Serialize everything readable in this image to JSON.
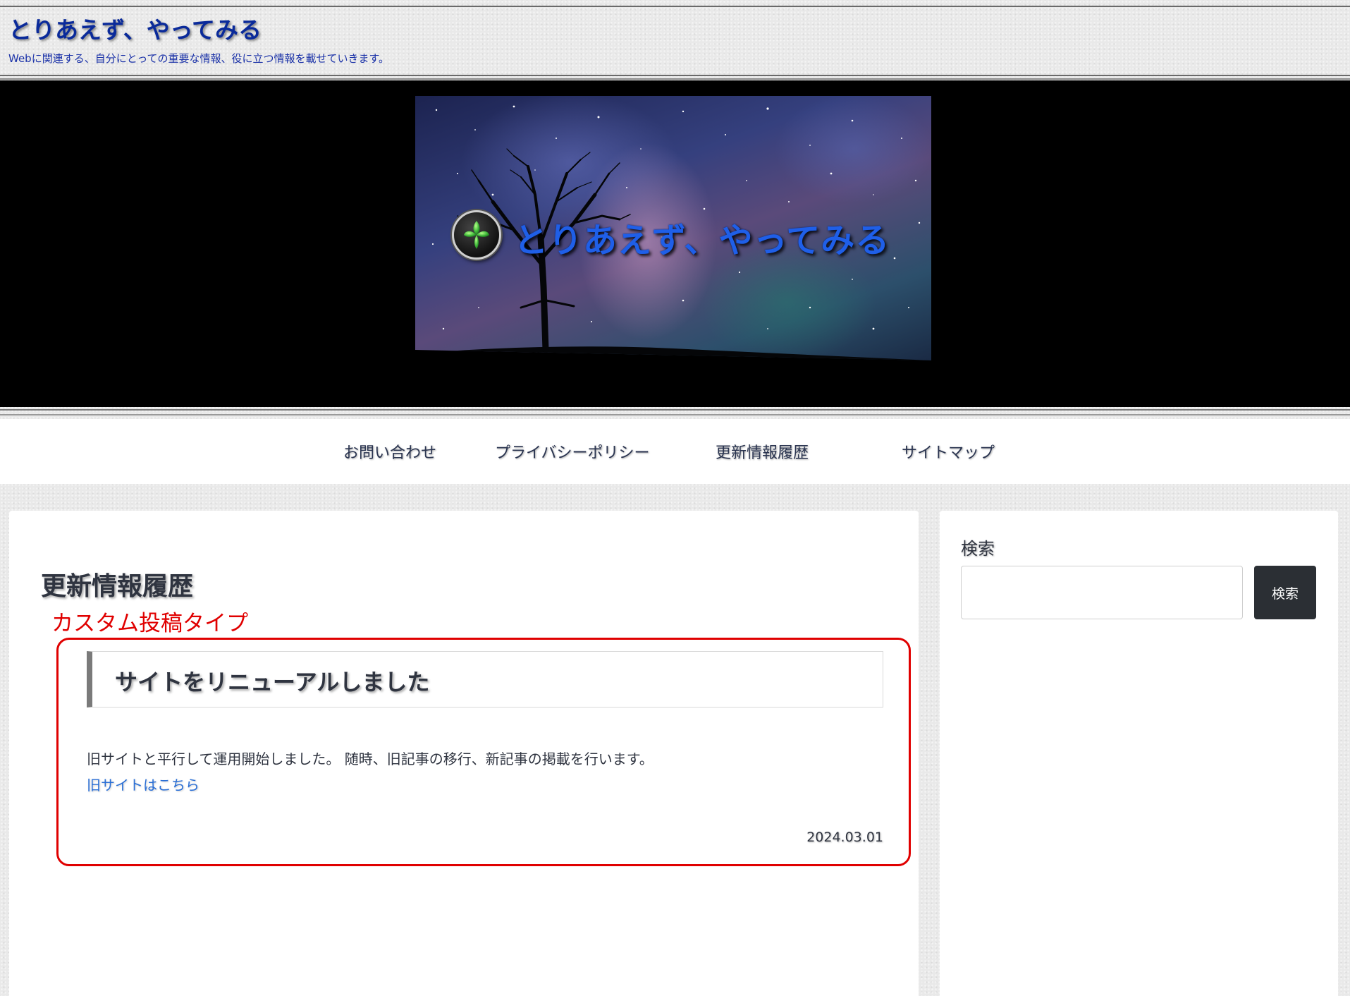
{
  "header": {
    "site_title": "とりあえず、やってみる",
    "tagline": "Webに関連する、自分にとっての重要な情報、役に立つ情報を載せていきます。"
  },
  "hero": {
    "banner_title": "とりあえず、やってみる",
    "logo_icon": "fleur-de-lis-icon"
  },
  "nav": {
    "items": [
      {
        "label": "お問い合わせ"
      },
      {
        "label": "プライバシーポリシー"
      },
      {
        "label": "更新情報履歴"
      },
      {
        "label": "サイトマップ"
      }
    ]
  },
  "main": {
    "page_title": "更新情報履歴",
    "annotation_label": "カスタム投稿タイプ",
    "post": {
      "heading": "サイトをリニューアルしました",
      "body": "旧サイトと平行して運用開始しました。 随時、旧記事の移行、新記事の掲載を行います。",
      "link_text": "旧サイトはこちら",
      "date": "2024.03.01"
    }
  },
  "sidebar": {
    "widget_title": "検索",
    "search_value": "",
    "search_button_label": "検索"
  },
  "colors": {
    "site_title": "#0a2a9a",
    "annotation": "#e00000",
    "link": "#2a6fd6",
    "search_button_bg": "#2b2f34"
  }
}
